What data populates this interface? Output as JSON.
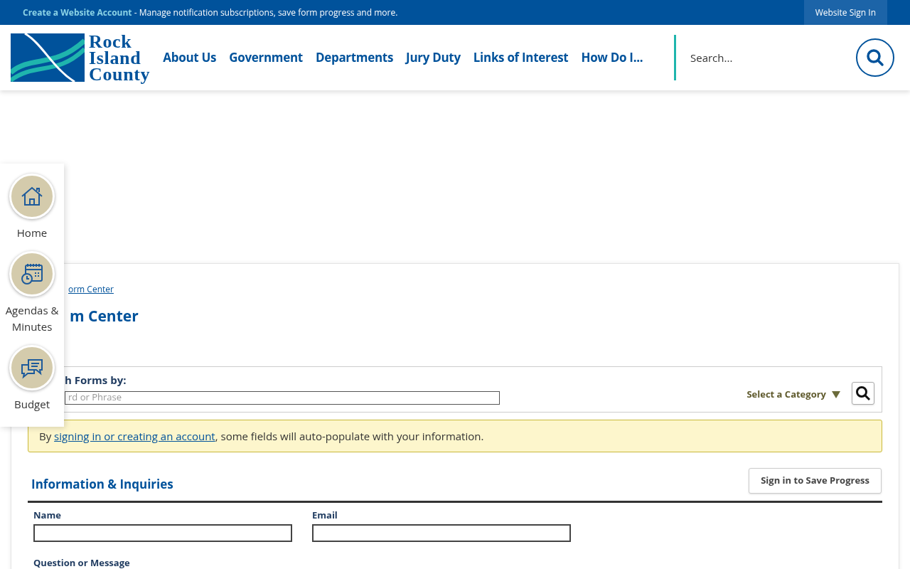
{
  "top_bar": {
    "link": "Create a Website Account",
    "message": " - Manage notification subscriptions, save form progress and more.",
    "sign_in": "Website Sign In"
  },
  "header": {
    "logo_lines": [
      "Rock",
      "Island",
      "County"
    ],
    "nav": [
      "About Us",
      "Government",
      "Departments",
      "Jury Duty",
      "Links of Interest",
      "How Do I..."
    ],
    "search": {
      "placeholder": "Search..."
    }
  },
  "quick_links": [
    {
      "label": "Home",
      "kind": "home"
    },
    {
      "label": "Agendas & Minutes",
      "kind": "calendar"
    },
    {
      "label": "Budget",
      "kind": "chat"
    }
  ],
  "breadcrumb": "orm Center",
  "title": "m Center",
  "search_forms": {
    "label": "h Forms by:",
    "placeholder": "rd or Phrase",
    "category": "Select a Category"
  },
  "notice": {
    "before": "By ",
    "link": "signing in or creating an account",
    "after": ", some fields will auto-populate with your information."
  },
  "form": {
    "title": "Information & Inquiries",
    "save_button": "Sign in to Save Progress",
    "fields": [
      {
        "label": "Name"
      },
      {
        "label": "Email"
      }
    ],
    "next_label": "Question or Message"
  }
}
